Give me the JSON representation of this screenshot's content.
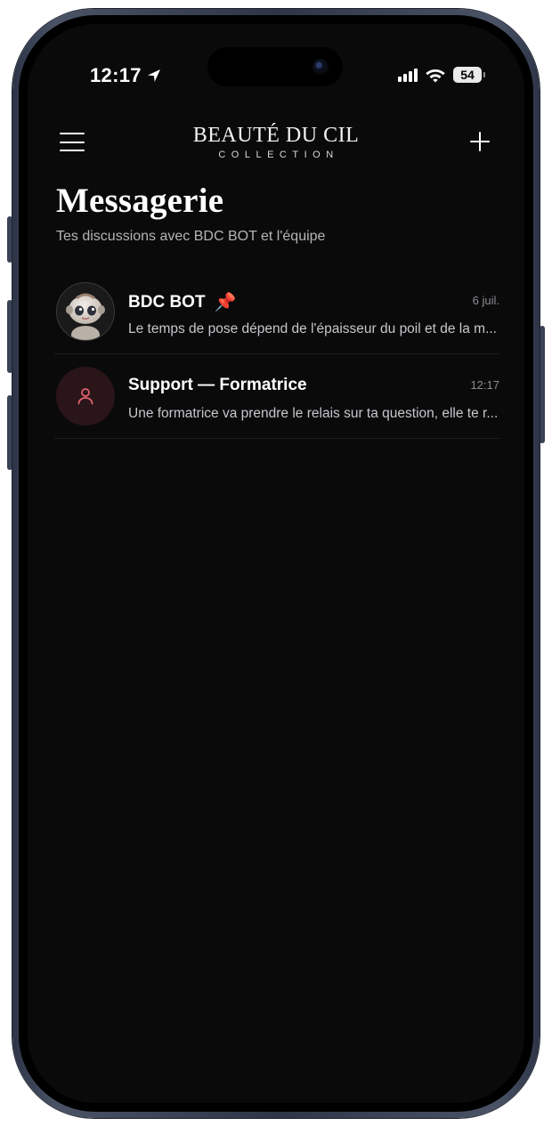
{
  "status_bar": {
    "time": "12:17",
    "battery": "54",
    "icons": [
      "location-arrow-icon",
      "signal-icon",
      "wifi-icon",
      "battery-icon"
    ]
  },
  "header": {
    "brand_name": "BEAUTÉ DU CIL",
    "brand_sub": "COLLECTION",
    "menu_icon": "hamburger-menu-icon",
    "add_icon": "plus-icon"
  },
  "page": {
    "title": "Messagerie",
    "subtitle": "Tes discussions avec BDC BOT et l'équipe"
  },
  "conversations": [
    {
      "name": "BDC BOT",
      "pinned": "📌",
      "time": "6 juil.",
      "preview": "Le temps de pose dépend de l'épaisseur du poil et de la m...",
      "avatar": "robot-avatar"
    },
    {
      "name": "Support — Formatrice",
      "time": "12:17",
      "preview": "Une formatrice va prendre le relais sur ta question, elle te r...",
      "avatar": "person-icon"
    }
  ],
  "colors": {
    "background": "#0a0a0b",
    "text": "#ffffff",
    "muted": "#8e8e93",
    "support_avatar_bg": "#2a1519",
    "support_icon": "#e0606e"
  }
}
